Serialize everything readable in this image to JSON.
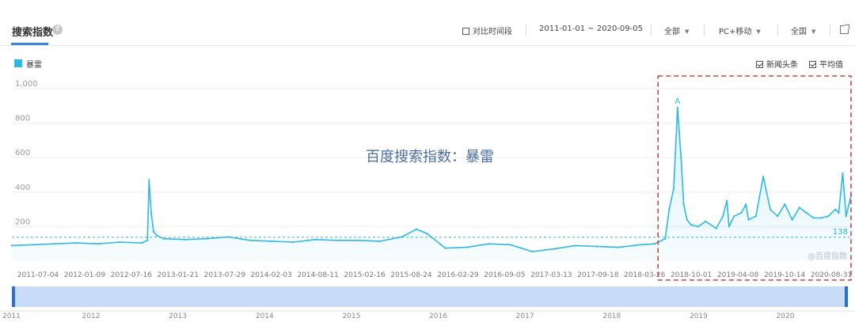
{
  "header": {
    "title": "搜索指数",
    "help_icon": "?",
    "compare_label": "对比时间段",
    "date_range": "2011-01-01 ~ 2020-09-05",
    "source_select": "全部",
    "device_select": "PC+移动",
    "region_select": "全国"
  },
  "legend": {
    "series_name": "暴雷",
    "color": "#2eb8e6"
  },
  "options": {
    "news_label": "新闻头条",
    "avg_label": "平均值"
  },
  "watermark": "百度搜索指数：暴雷",
  "credit": "@百度指数",
  "colors": {
    "accent": "#3b84d9",
    "line": "#2eb8e6",
    "highlight_box": "#b22222",
    "slider": "#c9dcf7",
    "slider_handle": "#2a6fd6"
  },
  "chart_data": {
    "type": "line",
    "series": [
      {
        "name": "暴雷",
        "x": [
          "2011-01-01",
          "2011-04-01",
          "2011-07-01",
          "2011-10-01",
          "2012-01-01",
          "2012-04-01",
          "2012-07-01",
          "2012-07-25",
          "2012-08-01",
          "2012-08-10",
          "2012-08-20",
          "2012-09-01",
          "2012-10-01",
          "2013-01-01",
          "2013-04-01",
          "2013-07-01",
          "2013-10-01",
          "2014-01-01",
          "2014-04-01",
          "2014-07-01",
          "2014-10-01",
          "2015-01-01",
          "2015-04-01",
          "2015-07-01",
          "2015-09-01",
          "2015-10-15",
          "2016-01-01",
          "2016-04-01",
          "2016-07-01",
          "2016-10-01",
          "2017-01-01",
          "2017-04-01",
          "2017-07-01",
          "2017-10-01",
          "2018-01-01",
          "2018-04-01",
          "2018-06-01",
          "2018-07-01",
          "2018-07-15",
          "2018-08-01",
          "2018-08-20",
          "2018-09-05",
          "2018-09-20",
          "2018-10-01",
          "2018-10-15",
          "2018-11-01",
          "2018-12-01",
          "2019-01-01",
          "2019-02-15",
          "2019-03-15",
          "2019-04-01",
          "2019-04-10",
          "2019-05-01",
          "2019-06-01",
          "2019-06-20",
          "2019-07-01",
          "2019-08-01",
          "2019-09-01",
          "2019-10-01",
          "2019-11-01",
          "2019-12-01",
          "2020-01-01",
          "2020-02-01",
          "2020-03-01",
          "2020-04-01",
          "2020-05-01",
          "2020-06-01",
          "2020-07-01",
          "2020-07-15",
          "2020-08-01",
          "2020-08-15",
          "2020-09-05"
        ],
        "values": [
          90,
          95,
          100,
          105,
          100,
          110,
          105,
          120,
          470,
          280,
          170,
          150,
          130,
          125,
          130,
          140,
          120,
          115,
          110,
          125,
          120,
          120,
          115,
          140,
          185,
          160,
          75,
          80,
          100,
          95,
          55,
          70,
          90,
          85,
          80,
          95,
          100,
          120,
          130,
          300,
          420,
          890,
          600,
          330,
          240,
          210,
          200,
          230,
          190,
          260,
          350,
          200,
          260,
          280,
          330,
          240,
          260,
          490,
          300,
          260,
          330,
          240,
          310,
          280,
          250,
          250,
          260,
          300,
          280,
          510,
          260,
          380
        ]
      }
    ],
    "average": 138,
    "peak_marker": "A",
    "ylim": [
      0,
      1000
    ],
    "y_ticks": [
      200,
      400,
      600,
      800,
      1000
    ],
    "y_tick_labels": [
      "200",
      "400",
      "600",
      "800",
      "1,000"
    ],
    "x_tick_labels": [
      "2011-07-04",
      "2012-01-09",
      "2012-07-16",
      "2013-01-21",
      "2013-07-29",
      "2014-02-03",
      "2014-08-11",
      "2015-02-16",
      "2015-08-24",
      "2016-02-29",
      "2016-09-05",
      "2017-03-13",
      "2017-09-18",
      "2018-03-26",
      "2018-10-01",
      "2019-04-08",
      "2019-10-14",
      "2020-08-31"
    ],
    "overview_years": [
      "2011",
      "2012",
      "2013",
      "2014",
      "2015",
      "2016",
      "2017",
      "2018",
      "2019",
      "2020"
    ],
    "highlight_range": [
      "2018-06-15",
      "2020-09-05"
    ],
    "grid": true,
    "legend_position": "top-left"
  }
}
